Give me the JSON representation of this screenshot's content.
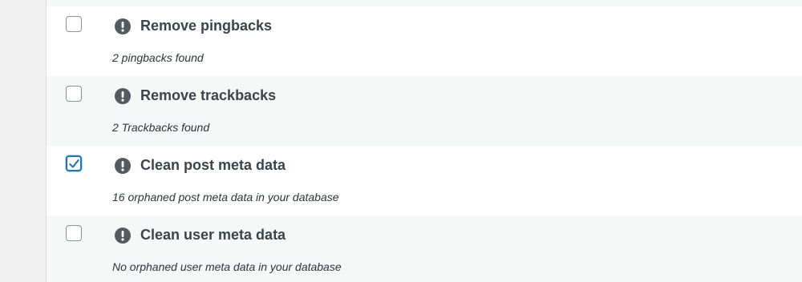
{
  "optimizations": [
    {
      "title": "Remove pingbacks",
      "description": "2 pingbacks found",
      "checked": false
    },
    {
      "title": "Remove trackbacks",
      "description": "2 Trackbacks found",
      "checked": false
    },
    {
      "title": "Clean post meta data",
      "description": "16 orphaned post meta data in your database",
      "checked": true
    },
    {
      "title": "Clean user meta data",
      "description": "No orphaned user meta data in your database",
      "checked": false
    }
  ],
  "icons": {
    "status": "exclamation-circle-icon",
    "check": "checkmark-icon"
  },
  "colors": {
    "checkbox_checked_border": "#2271b1",
    "icon_fill": "#555a60",
    "row_alt_background": "#f6f7f7"
  }
}
